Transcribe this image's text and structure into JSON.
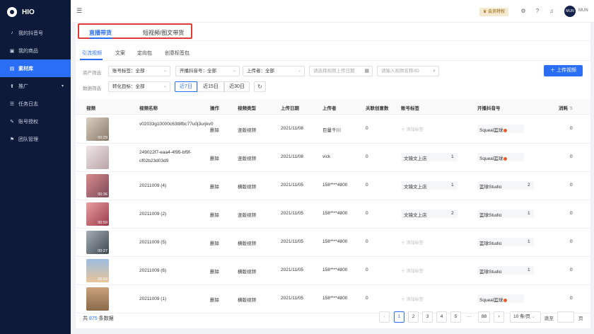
{
  "app": {
    "logo_text": "HIO"
  },
  "sidebar": {
    "items": [
      {
        "label": "我的抖音号",
        "icon": "douyin-icon"
      },
      {
        "label": "我的商品",
        "icon": "product-icon"
      },
      {
        "label": "素材库",
        "icon": "library-icon",
        "active": true
      },
      {
        "label": "推广",
        "icon": "promote-icon",
        "arrow": "▾"
      },
      {
        "label": "任务日志",
        "icon": "log-icon"
      },
      {
        "label": "账号授权",
        "icon": "auth-icon"
      },
      {
        "label": "团队管理",
        "icon": "team-icon"
      }
    ]
  },
  "topbar": {
    "vip_label": "会员特权",
    "avatar_text": "MUN",
    "user_name": "MUN"
  },
  "type_tabs": [
    "直播带货",
    "短视频/图文带货"
  ],
  "sub_tabs": [
    "引流视频",
    "文案",
    "定向包",
    "创意标签包"
  ],
  "filters": {
    "row1_label": "资产筛选",
    "row2_label": "数据筛选",
    "account_tag": "账号标签：全部",
    "live_account": "开播抖音号：全部",
    "uploader": "上传者：全部",
    "date_placeholder": "请选择视频上传日期",
    "search_placeholder": "请输入视频名称/ID",
    "target": "转化目标：全部",
    "upload_button": "上传视频",
    "ranges": [
      "近7日",
      "近15日",
      "近30日"
    ]
  },
  "table": {
    "headers": [
      "视频",
      "视频名称",
      "操作",
      "视频类型",
      "上传日期",
      "上传者",
      "关联创意数",
      "账号标签",
      "开播抖音号",
      "消耗"
    ],
    "rows": [
      {
        "name": "v02033g10000c63t8fbc77u0j3urjkv0",
        "action": "删除",
        "type": "竖版视频",
        "date": "2021/11/08",
        "uploader": "巨量千川",
        "creatives": "0",
        "tag": "添加标签",
        "tag_count": "",
        "douyin": "Squeal篮球",
        "douyin_count": "",
        "douyin_dot": true,
        "cost": "0",
        "duration": "00:29",
        "thumb": "linear-gradient(135deg,#d9cfc2,#8a7a6a)"
      },
      {
        "name": "249022f7-eaa4-4f95-bf9f-cf02b23d03d9",
        "action": "删除",
        "type": "竖版视频",
        "date": "2021/11/08",
        "uploader": "vick",
        "creatives": "0",
        "tag": "文镜文上店",
        "tag_count": "1",
        "douyin": "Squeal篮球",
        "douyin_count": "",
        "douyin_dot": true,
        "cost": "0",
        "duration": "",
        "thumb": "linear-gradient(135deg,#efe6e6,#b9a3a6)"
      },
      {
        "name": "20211009 (4)",
        "action": "删除",
        "type": "横版视频",
        "date": "2021/11/05",
        "uploader": "158****4800",
        "creatives": "0",
        "tag": "文镜文上店",
        "tag_count": "1",
        "douyin": "篮球Studio",
        "douyin_count": "2",
        "douyin_dot": false,
        "cost": "0",
        "duration": "00:36",
        "thumb": "linear-gradient(135deg,#d98a8a,#7a4a5a)"
      },
      {
        "name": "20211009 (2)",
        "action": "删除",
        "type": "竖版视频",
        "date": "2021/11/05",
        "uploader": "158****4800",
        "creatives": "0",
        "tag": "文镜文上店",
        "tag_count": "2",
        "douyin": "篮球Studio",
        "douyin_count": "1",
        "douyin_dot": false,
        "cost": "0",
        "duration": "00:59",
        "thumb": "linear-gradient(135deg,#e8a0a0,#9a3a4a)"
      },
      {
        "name": "20211009 (5)",
        "action": "删除",
        "type": "横版视频",
        "date": "2021/11/05",
        "uploader": "158****4800",
        "creatives": "0",
        "tag": "添加标签",
        "tag_count": "",
        "douyin": "篮球Studio",
        "douyin_count": "1",
        "douyin_dot": false,
        "cost": "0",
        "duration": "00:27",
        "thumb": "linear-gradient(135deg,#a6adb5,#3d4852)"
      },
      {
        "name": "20211009 (6)",
        "action": "删除",
        "type": "横版视频",
        "date": "2021/11/05",
        "uploader": "158****4800",
        "creatives": "0",
        "tag": "添加标签",
        "tag_count": "",
        "douyin": "篮球Studio",
        "douyin_count": "1",
        "douyin_dot": false,
        "cost": "0",
        "duration": "00:29",
        "thumb": "linear-gradient(180deg,#9bbde0,#e8c59a)"
      },
      {
        "name": "20211009 (1)",
        "action": "删除",
        "type": "横版视频",
        "date": "2021/11/05",
        "uploader": "158****4800",
        "creatives": "0",
        "tag": "添加标签",
        "tag_count": "",
        "douyin": "Squeal篮球",
        "douyin_count": "",
        "douyin_dot": true,
        "cost": "0",
        "duration": "",
        "thumb": "linear-gradient(180deg,#c9a27a,#8a6a4a)"
      }
    ]
  },
  "footer": {
    "total_prefix": "共 ",
    "total_count": "875",
    "total_suffix": " 条数据",
    "pages": [
      "1",
      "2",
      "3",
      "4",
      "5"
    ],
    "ellipsis": "···",
    "last_page": "88",
    "prev": "‹",
    "next": "›",
    "page_size": "10 条/页",
    "jump_label": "跳至",
    "page_unit": "页"
  }
}
